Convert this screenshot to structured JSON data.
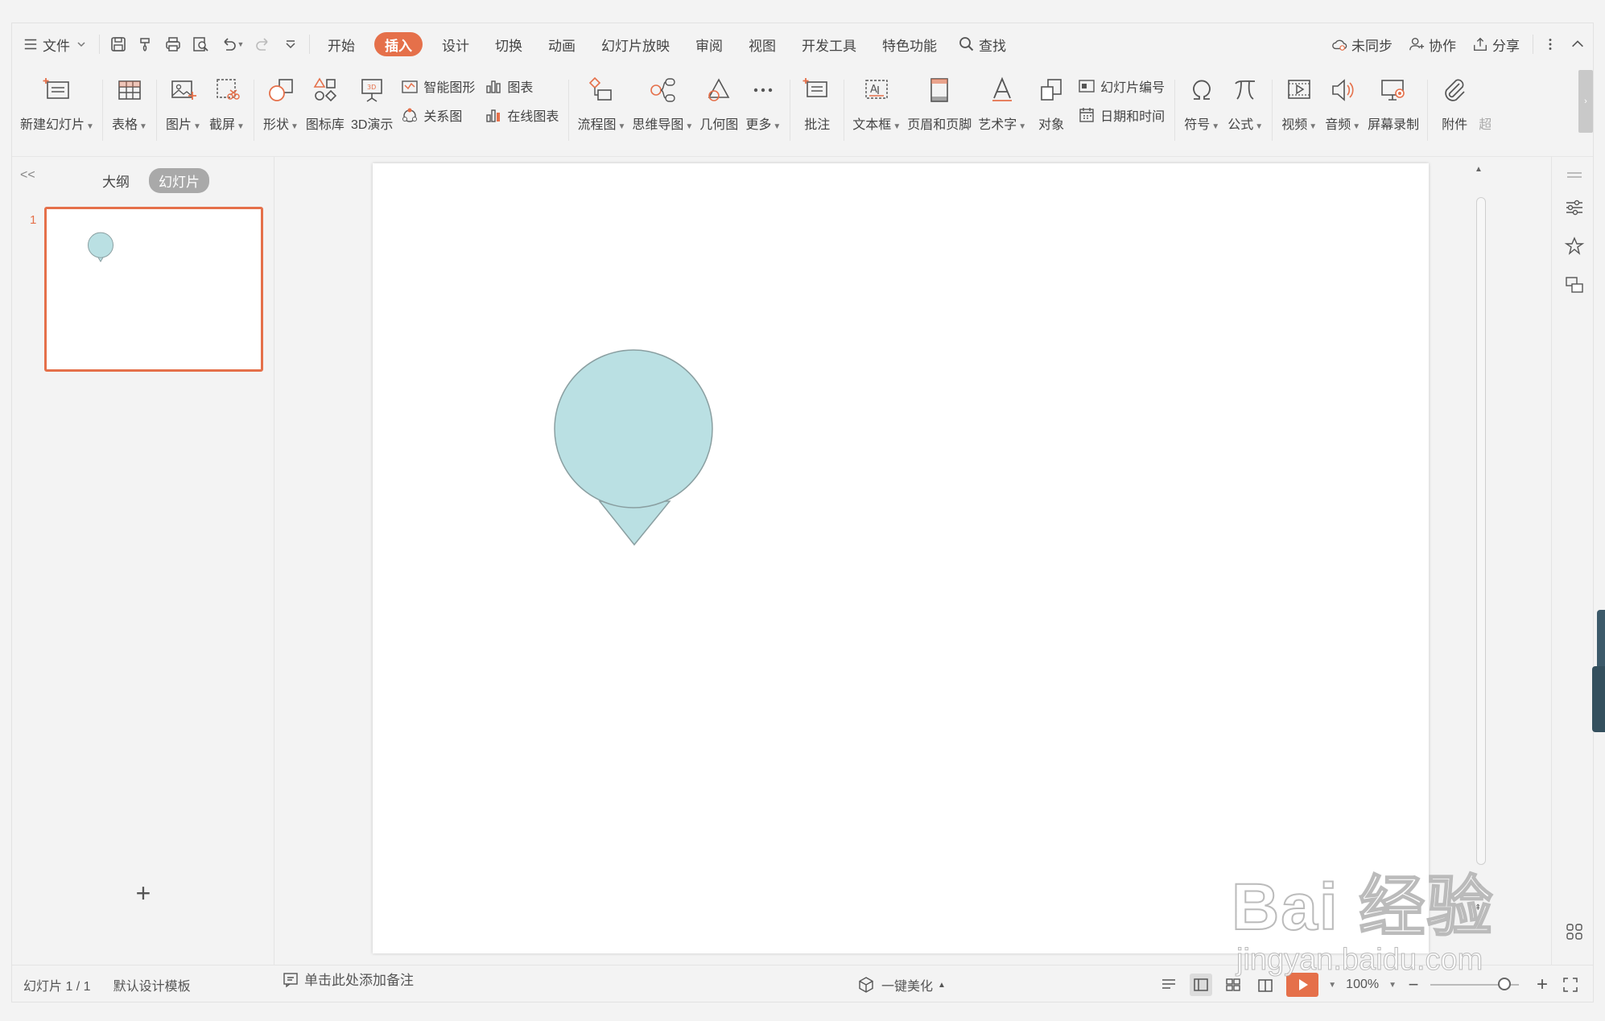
{
  "menubar": {
    "file_label": "文件",
    "tabs": [
      {
        "label": "开始"
      },
      {
        "label": "插入"
      },
      {
        "label": "设计"
      },
      {
        "label": "切换"
      },
      {
        "label": "动画"
      },
      {
        "label": "幻灯片放映"
      },
      {
        "label": "审阅"
      },
      {
        "label": "视图"
      },
      {
        "label": "开发工具"
      },
      {
        "label": "特色功能"
      }
    ],
    "active_tab": "插入",
    "search_label": "查找",
    "sync_label": "未同步",
    "collab_label": "协作",
    "share_label": "分享"
  },
  "ribbon": {
    "new_slide": "新建幻灯片",
    "table": "表格",
    "picture": "图片",
    "screenshot": "截屏",
    "shape": "形状",
    "icon_lib": "图标库",
    "demo3d": "3D演示",
    "smart_graphic": "智能图形",
    "relation": "关系图",
    "chart": "图表",
    "online_chart": "在线图表",
    "flowchart": "流程图",
    "mindmap": "思维导图",
    "geometry": "几何图",
    "more": "更多",
    "comment": "批注",
    "textbox": "文本框",
    "header_footer": "页眉和页脚",
    "wordart": "艺术字",
    "object": "对象",
    "slide_number": "幻灯片编号",
    "datetime": "日期和时间",
    "symbol": "符号",
    "formula": "公式",
    "video": "视频",
    "audio": "音频",
    "screen_record": "屏幕录制",
    "attachment": "附件",
    "hyperlink": "超"
  },
  "leftpanel": {
    "collapse": "<<",
    "tab_outline": "大纲",
    "tab_slides": "幻灯片",
    "slide_number": "1",
    "add_slide": "+"
  },
  "notes_placeholder": "单击此处添加备注",
  "statusbar": {
    "slide_info": "幻灯片 1 / 1",
    "template": "默认设计模板",
    "beautify": "一键美化",
    "zoom": "100%"
  },
  "shape": {
    "fill": "#bae0e3",
    "stroke": "#8a9fa1"
  },
  "watermark": {
    "logo": "Bai 经验",
    "url": "jingyan.baidu.com"
  },
  "colors": {
    "accent": "#e5704a"
  }
}
